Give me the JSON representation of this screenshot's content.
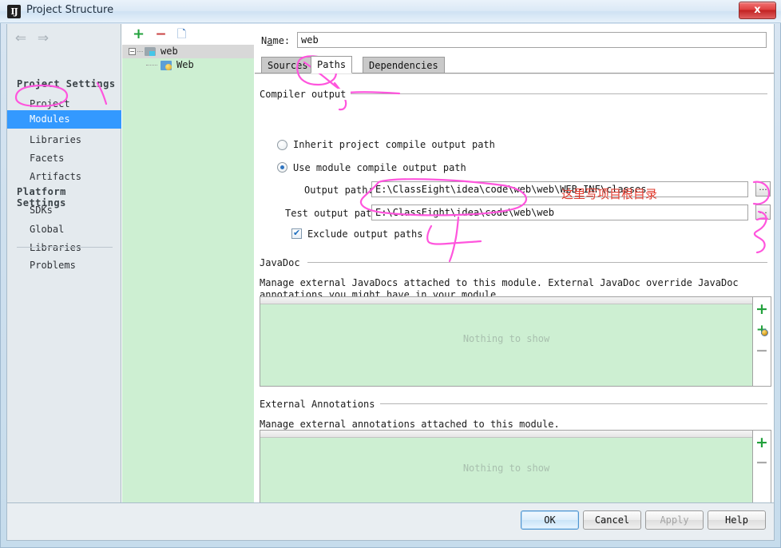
{
  "window": {
    "title": "Project Structure",
    "app_icon": "intellij-idea-icon",
    "close_label": "x"
  },
  "sidebar": {
    "nav": {
      "back": "⇐",
      "forward": "⇒"
    },
    "groups": [
      {
        "title": "Project Settings",
        "items": [
          {
            "label": "Project",
            "selected": false
          },
          {
            "label": "Modules",
            "selected": true
          },
          {
            "label": "Libraries",
            "selected": false
          },
          {
            "label": "Facets",
            "selected": false
          },
          {
            "label": "Artifacts",
            "selected": false
          }
        ]
      },
      {
        "title": "Platform Settings",
        "items": [
          {
            "label": "SDKs",
            "selected": false
          },
          {
            "label": "Global Libraries",
            "selected": false
          }
        ]
      }
    ],
    "footer_items": [
      {
        "label": "Problems",
        "selected": false
      }
    ]
  },
  "tree": {
    "toolbar": {
      "add": "+",
      "remove": "−",
      "copy": "copy-icon"
    },
    "nodes": [
      {
        "label": "web",
        "icon": "module-folder-icon",
        "selected": true,
        "depth": 0,
        "expanded": true
      },
      {
        "label": "Web",
        "icon": "web-facet-icon",
        "selected": false,
        "depth": 1
      }
    ]
  },
  "main": {
    "name_label": "Name:",
    "name_value": "web",
    "tabs": [
      {
        "label": "Sources",
        "active": false
      },
      {
        "label": "Paths",
        "active": true
      },
      {
        "label": "Dependencies",
        "active": false
      }
    ],
    "compiler_output": {
      "section_title": "Compiler output",
      "radio_inherit": {
        "label": "Inherit project compile output path",
        "selected": false
      },
      "radio_module": {
        "label": "Use module compile output path",
        "selected": true
      },
      "output_path": {
        "label": "Output path:",
        "value": "E:\\ClassEight\\idea\\code\\web\\web\\WEB-INF\\classes",
        "browse": "..."
      },
      "test_output_path": {
        "label": "Test output path:",
        "value": "E:\\ClassEight\\idea\\code\\web\\web",
        "browse": "..."
      },
      "exclude_checkbox": {
        "label": "Exclude output paths",
        "checked": true
      }
    },
    "javadoc": {
      "section_title": "JavaDoc",
      "description": "Manage external JavaDocs attached to this module. External JavaDoc override JavaDoc annotations you might have in your module.",
      "empty_text": "Nothing to show",
      "buttons": [
        {
          "name": "add",
          "glyph": "+"
        },
        {
          "name": "add-from-url",
          "glyph": "+"
        },
        {
          "name": "remove",
          "glyph": "−"
        }
      ]
    },
    "external_annotations": {
      "section_title": "External Annotations",
      "description": "Manage external annotations attached to this module.",
      "empty_text": "Nothing to show",
      "buttons": [
        {
          "name": "add",
          "glyph": "+"
        },
        {
          "name": "remove",
          "glyph": "−"
        }
      ]
    }
  },
  "footer": {
    "ok": "OK",
    "cancel": "Cancel",
    "apply": "Apply",
    "help": "Help"
  },
  "annotations": {
    "ink_color": "#ff55dd",
    "note_text": "这里写项目根目录",
    "note_color": "#e23b2e"
  }
}
